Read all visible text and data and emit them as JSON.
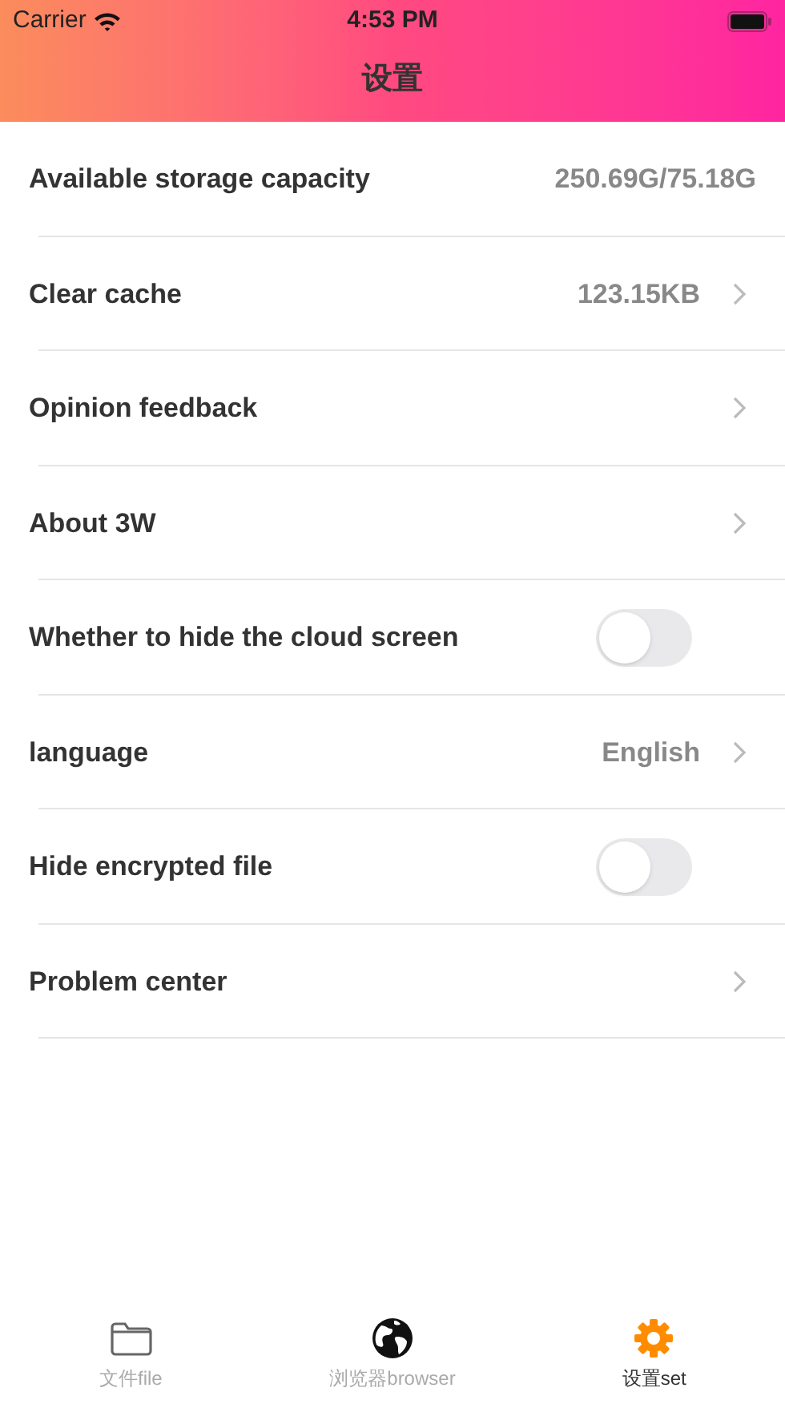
{
  "status_bar": {
    "carrier": "Carrier",
    "time": "4:53 PM"
  },
  "title": "设置",
  "rows": [
    {
      "kind": "value",
      "label": "Available storage capacity",
      "value": "250.69G/75.18G"
    },
    {
      "kind": "link",
      "label": "Clear cache",
      "value": "123.15KB"
    },
    {
      "kind": "link",
      "label": "Opinion feedback"
    },
    {
      "kind": "link",
      "label": "About 3W"
    },
    {
      "kind": "toggle",
      "label": "Whether to hide the cloud screen",
      "on": false
    },
    {
      "kind": "link",
      "label": "language",
      "value": "English"
    },
    {
      "kind": "toggle",
      "label": "Hide encrypted file",
      "on": false
    },
    {
      "kind": "link",
      "label": "Problem center"
    }
  ],
  "tabs": [
    {
      "kind": "folder",
      "label": "文件file",
      "selected": false
    },
    {
      "kind": "globe",
      "label": "浏览器browser",
      "selected": false
    },
    {
      "kind": "gear",
      "label": "设置set",
      "selected": true
    }
  ]
}
